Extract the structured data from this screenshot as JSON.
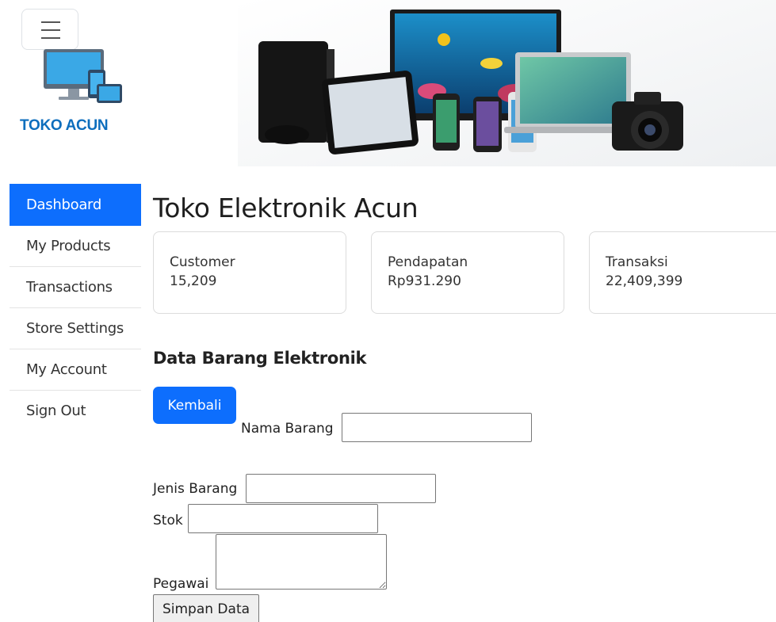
{
  "brand": {
    "name": "TOKO ACUN"
  },
  "icons": {
    "menu": "hamburger-menu-icon",
    "logo": "computer-devices-logo-icon"
  },
  "colors": {
    "primary": "#0d6efd",
    "brand": "#0d6ebd"
  },
  "sidebar": {
    "items": [
      {
        "label": "Dashboard",
        "active": true
      },
      {
        "label": "My Products"
      },
      {
        "label": "Transactions"
      },
      {
        "label": "Store Settings"
      },
      {
        "label": "My Account"
      },
      {
        "label": "Sign Out"
      }
    ]
  },
  "main": {
    "title": "Toko Elektronik Acun",
    "stats": [
      {
        "label": "Customer",
        "value": "15,209"
      },
      {
        "label": "Pendapatan",
        "value": "Rp931.290"
      },
      {
        "label": "Transaksi",
        "value": "22,409,399"
      }
    ],
    "section_title": "Data Barang Elektronik"
  },
  "form": {
    "back_label": "Kembali",
    "fields": {
      "nama": {
        "label": "Nama Barang",
        "value": ""
      },
      "jenis": {
        "label": "Jenis Barang",
        "value": ""
      },
      "stok": {
        "label": "Stok",
        "value": ""
      },
      "pegawai": {
        "label": "Pegawai",
        "value": ""
      }
    },
    "submit_label": "Simpan Data"
  }
}
